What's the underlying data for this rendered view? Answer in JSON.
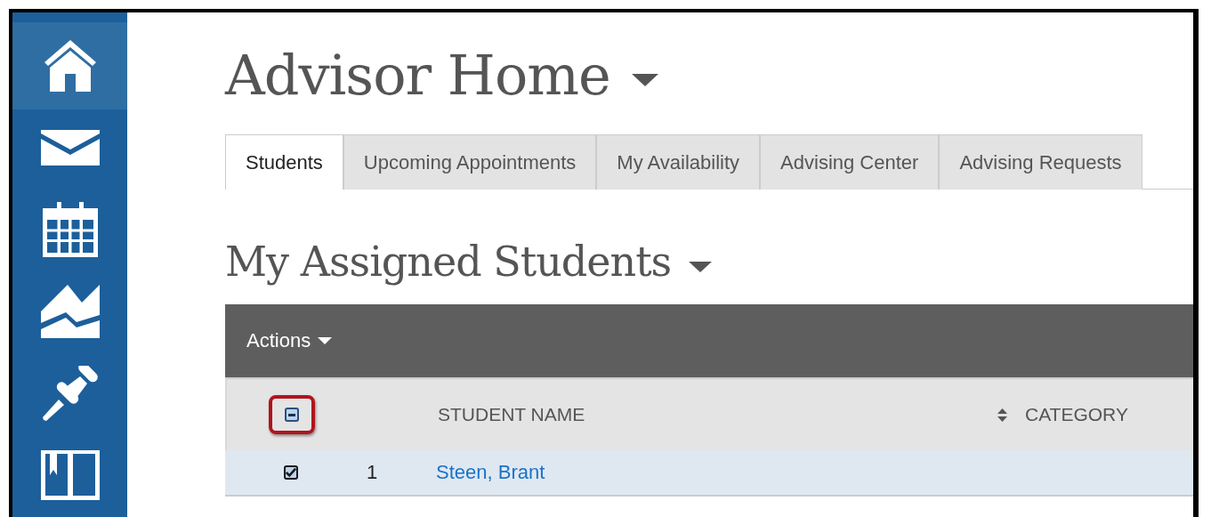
{
  "sidebar": {
    "items": [
      {
        "kind": "home",
        "selected": true
      },
      {
        "kind": "mail",
        "selected": false
      },
      {
        "kind": "calendar",
        "selected": false
      },
      {
        "kind": "chart",
        "selected": false
      },
      {
        "kind": "pin",
        "selected": false
      },
      {
        "kind": "book",
        "selected": false
      }
    ]
  },
  "page_title": "Advisor Home",
  "tabs": [
    {
      "label": "Students",
      "selected": true
    },
    {
      "label": "Upcoming Appointments",
      "selected": false
    },
    {
      "label": "My Availability",
      "selected": false
    },
    {
      "label": "Advising Center",
      "selected": false
    },
    {
      "label": "Advising Requests",
      "selected": false
    }
  ],
  "section_title": "My Assigned Students",
  "actions_menu": {
    "label": "Actions"
  },
  "table": {
    "select_all": {
      "indeterminate": true,
      "highlighted": true
    },
    "columns": [
      {
        "label": "STUDENT NAME",
        "sortable": true
      },
      {
        "label": "CATEGORY",
        "sortable": false
      }
    ],
    "rows": [
      {
        "number": "1",
        "name": "Steen, Brant",
        "checked": true,
        "selected": true
      }
    ]
  }
}
